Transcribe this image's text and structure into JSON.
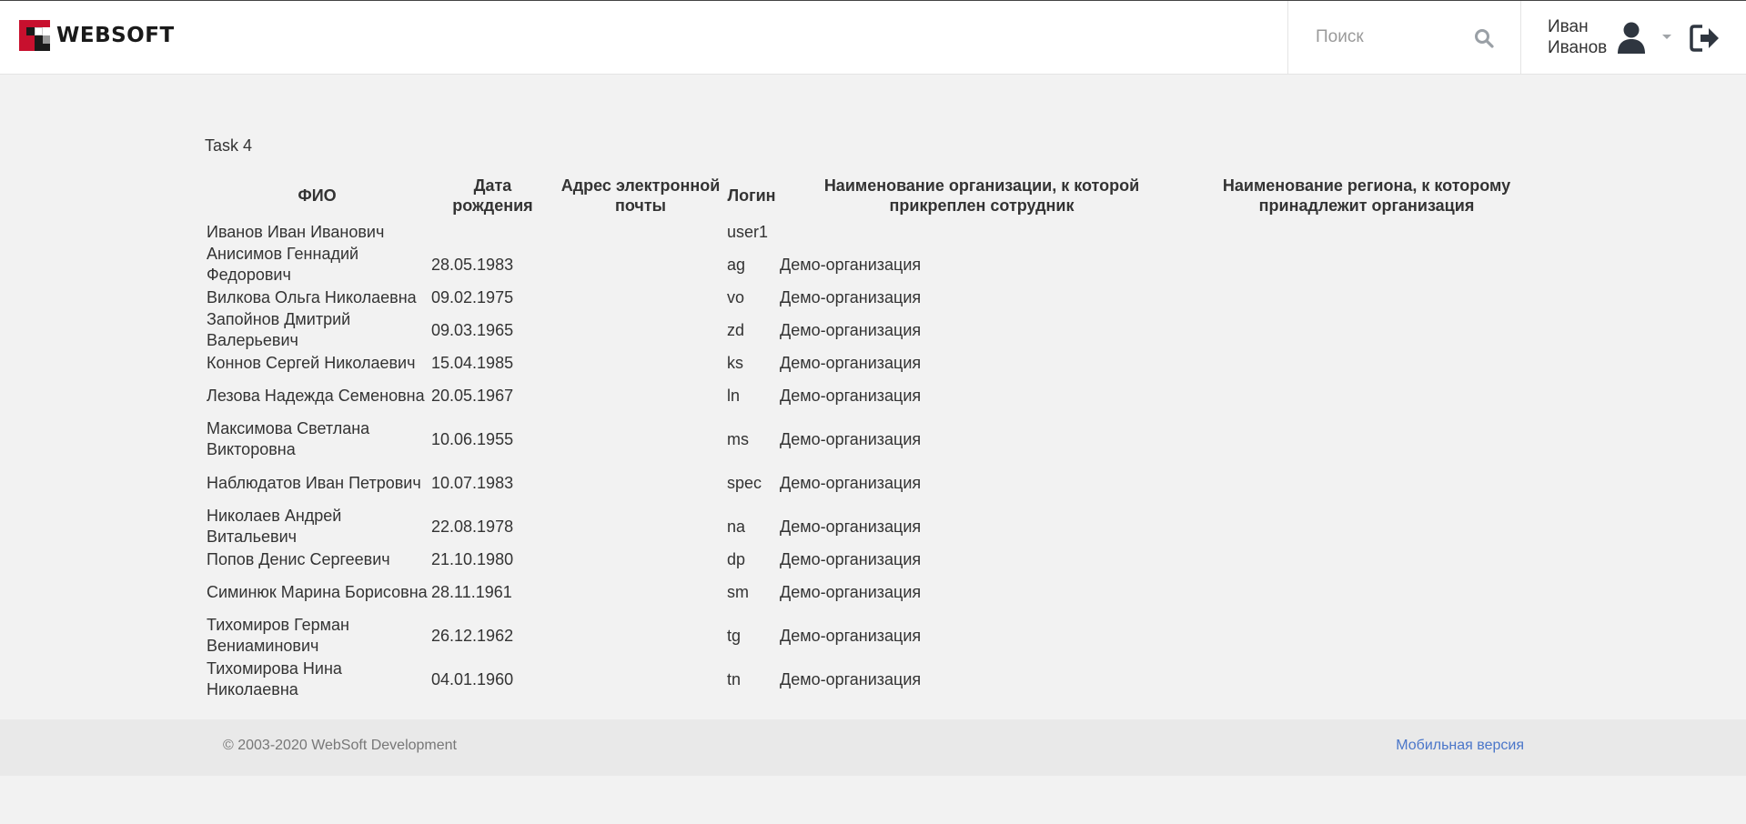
{
  "header": {
    "logo_text": "WEBSOFT",
    "search_placeholder": "Поиск",
    "user_first_name": "Иван",
    "user_last_name": "Иванов"
  },
  "main": {
    "title": "Task 4",
    "columns": [
      "ФИО",
      "Дата рождения",
      "Адрес электронной почты",
      "Логин",
      "Наименование организации, к которой прикреплен сотрудник",
      "Наименование региона, к которому принадлежит организация"
    ],
    "rows": [
      {
        "fio": "Иванов Иван Иванович",
        "birth": "",
        "email": "",
        "login": "user1",
        "org": "",
        "region": ""
      },
      {
        "fio": "Анисимов Геннадий Федорович",
        "birth": "28.05.1983",
        "email": "",
        "login": "ag",
        "org": "Демо-организация",
        "region": ""
      },
      {
        "fio": "Вилкова Ольга Николаевна",
        "birth": "09.02.1975",
        "email": "",
        "login": "vo",
        "org": "Демо-организация",
        "region": ""
      },
      {
        "fio": "Запойнов Дмитрий Валерьевич",
        "birth": "09.03.1965",
        "email": "",
        "login": "zd",
        "org": "Демо-организация",
        "region": ""
      },
      {
        "fio": "Коннов Сергей Николаевич",
        "birth": "15.04.1985",
        "email": "",
        "login": "ks",
        "org": "Демо-организация",
        "region": ""
      },
      {
        "fio": "Лезова Надежда Семеновна",
        "birth": "20.05.1967",
        "email": "",
        "login": "ln",
        "org": "Демо-организация",
        "region": ""
      },
      {
        "fio": "Максимова Светлана Викторовна",
        "birth": "10.06.1955",
        "email": "",
        "login": "ms",
        "org": "Демо-организация",
        "region": ""
      },
      {
        "fio": "Наблюдатов Иван Петрович",
        "birth": "10.07.1983",
        "email": "",
        "login": "spec",
        "org": "Демо-организация",
        "region": ""
      },
      {
        "fio": "Николаев Андрей Витальевич",
        "birth": "22.08.1978",
        "email": "",
        "login": "na",
        "org": "Демо-организация",
        "region": ""
      },
      {
        "fio": "Попов Денис Сергеевич",
        "birth": "21.10.1980",
        "email": "",
        "login": "dp",
        "org": "Демо-организация",
        "region": ""
      },
      {
        "fio": "Симинюк Марина Борисовна",
        "birth": "28.11.1961",
        "email": "",
        "login": "sm",
        "org": "Демо-организация",
        "region": ""
      },
      {
        "fio": "Тихомиров Герман Вениаминович",
        "birth": "26.12.1962",
        "email": "",
        "login": "tg",
        "org": "Демо-организация",
        "region": ""
      },
      {
        "fio": "Тихомирова Нина Николаевна",
        "birth": "04.01.1960",
        "email": "",
        "login": "tn",
        "org": "Демо-организация",
        "region": ""
      }
    ]
  },
  "footer": {
    "copyright": "© 2003-2020 WebSoft Development",
    "mobile_link": "Мобильная версия"
  },
  "icons": {
    "logo": "websoft-logo-icon",
    "search": "search-icon",
    "user": "user-avatar-icon",
    "caret": "chevron-down-icon",
    "logout": "logout-icon"
  },
  "colors": {
    "logo_red": "#c8102e",
    "logo_dark": "#1a1a1a",
    "link": "#4a76c9",
    "icon_dark": "#2f3640"
  }
}
